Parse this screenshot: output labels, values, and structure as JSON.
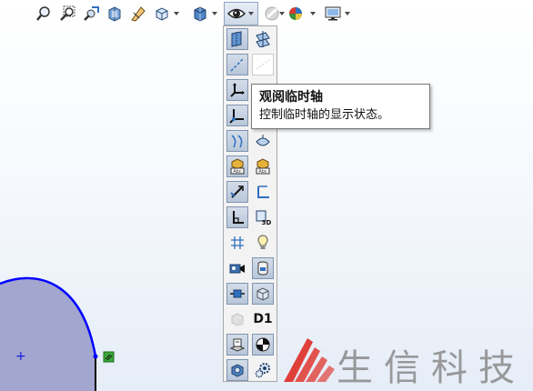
{
  "toolbar": {
    "icons": [
      "zoom-to-fit-icon",
      "zoom-to-area-icon",
      "previous-view-icon",
      "section-view-icon",
      "dynamic-annotation-icon",
      "view-orientation-icon",
      "display-style-icon",
      "hide-show-items-icon",
      "edit-appearance-icon",
      "apply-scene-icon",
      "view-settings-icon"
    ]
  },
  "palette": {
    "items": [
      [
        "view-planes-icon",
        "view-axes-icon"
      ],
      [
        "view-temporary-axes-icon",
        "view-points-icon"
      ],
      [
        "view-origins-icon",
        "view-coordinate-systems-icon"
      ],
      [
        "view-user-coordinate-icon",
        "view-curves-icon"
      ],
      [
        "view-parting-lines-icon",
        "view-surfaces-icon"
      ],
      [
        "view-annotations-icon",
        "view-dimension-names-icon"
      ],
      [
        "view-sketch-relations-icon",
        "view-sketches-icon"
      ],
      [
        "view-3d-sketch-planes-icon",
        "view-3d-sketches-icon"
      ],
      [
        "view-grid-icon",
        "view-lights-icon"
      ],
      [
        "view-cameras-icon",
        "view-decals-icon"
      ],
      [
        "view-weld-beads-icon",
        "view-routing-points-icon"
      ],
      [
        "view-sketch-dimensions-icon",
        "view-dimension-text-icon"
      ],
      [
        "view-bodies-icon",
        "view-center-of-mass-icon"
      ],
      [
        "view-live-section-planes-icon",
        "view-settings-gear-icon"
      ]
    ],
    "d1_text": "D1"
  },
  "tooltip": {
    "title": "观阅临时轴",
    "description": "控制临时轴的显示状态。"
  },
  "watermark": {
    "text": "生信科技",
    "logo_color": "#e0403a",
    "text_color": "#8a8a8a"
  },
  "sketch": {
    "fill": "#a3a6cf",
    "edge_color": "#0000ff",
    "origin_mark": "+"
  },
  "colors": {
    "pressed_bg": "#c5d2e3",
    "accent_blue": "#2f6fbf"
  }
}
